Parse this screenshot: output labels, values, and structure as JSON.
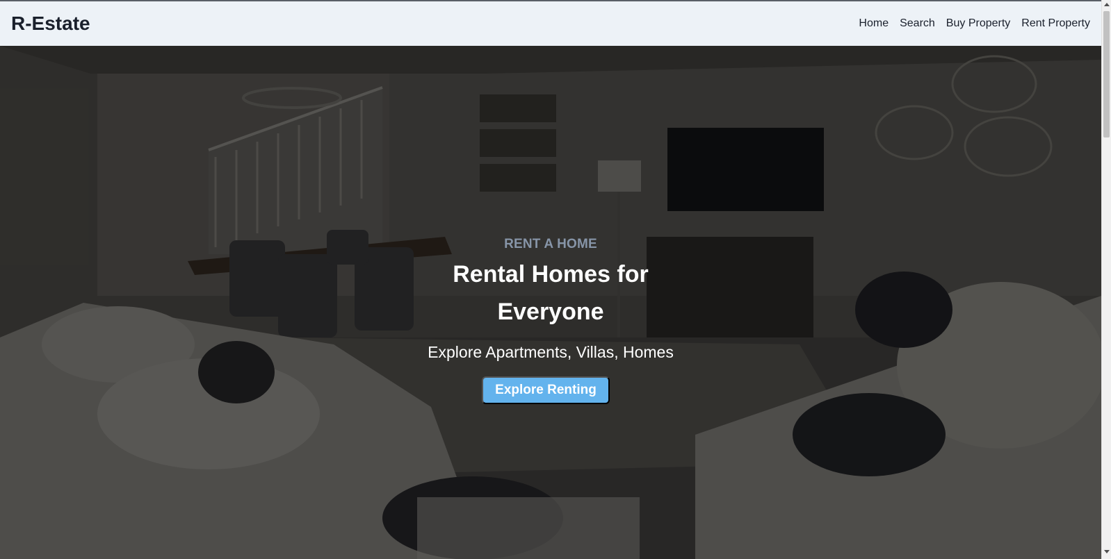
{
  "navbar": {
    "brand": "R-Estate",
    "links": [
      {
        "label": "Home"
      },
      {
        "label": "Search"
      },
      {
        "label": "Buy Property"
      },
      {
        "label": "Rent Property"
      }
    ]
  },
  "hero": {
    "eyebrow": "RENT A HOME",
    "headline_line1": "Rental Homes for",
    "headline_line2": "Everyone",
    "subtitle": "Explore Apartments, Villas, Homes",
    "cta_label": "Explore Renting",
    "background_icon": "living-room-photo"
  },
  "colors": {
    "navbar_bg": "#edf2f7",
    "brand_text": "#1a202c",
    "eyebrow": "#8795a8",
    "cta_bg": "#63b3ed"
  }
}
